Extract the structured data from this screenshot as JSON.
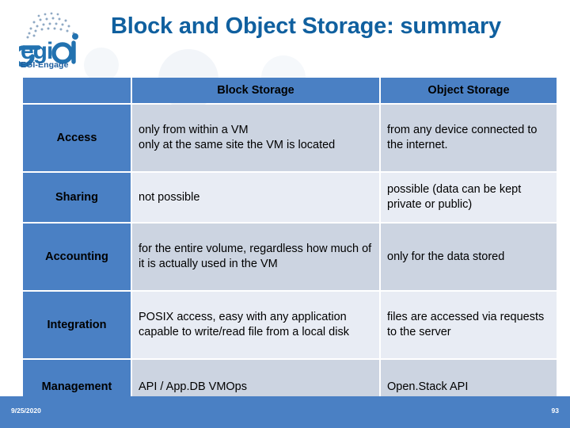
{
  "slide": {
    "title": "Block and Object Storage: summary",
    "accent_blue": "#4a80c4",
    "title_color": "#10609f",
    "row_dark": "#ccd4e1",
    "row_light": "#e8ecf4"
  },
  "logo": {
    "wordmark": "egi",
    "subtitle": "EGI-Engage"
  },
  "table": {
    "columns": [
      "",
      "Block Storage",
      "Object Storage"
    ],
    "rows": [
      {
        "label": "Access",
        "block": "only from within a VM\nonly at the same site the VM is located",
        "object": "from any device connected to the internet."
      },
      {
        "label": "Sharing",
        "block": "not possible",
        "object": "possible (data can be kept private or public)"
      },
      {
        "label": "Accounting",
        "block": "for the entire volume, regardless how much of it is actually used in the VM",
        "object": "only for the data stored"
      },
      {
        "label": "Integration",
        "block": "POSIX access, easy with any application capable to write/read file from a local disk",
        "object": "files are accessed via requests to the server"
      },
      {
        "label": "Management",
        "block": "API / App.DB VMOps",
        "object": "Open.Stack API"
      }
    ]
  },
  "footer": {
    "date": "9/25/2020",
    "page": "93"
  }
}
